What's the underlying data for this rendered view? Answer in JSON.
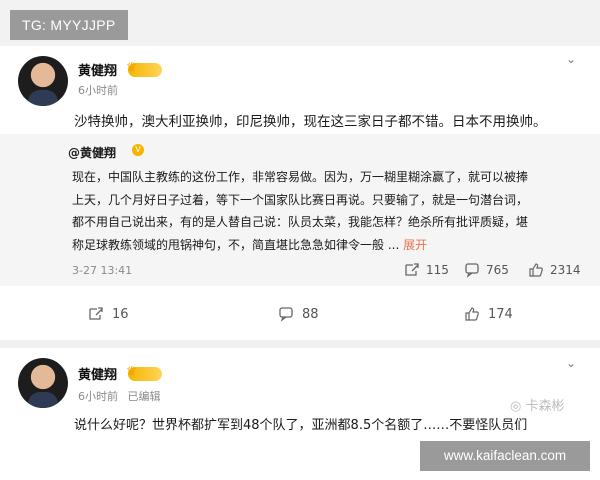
{
  "overlay": {
    "tg_label": "TG: MYYJJPP",
    "site_label": "www.kaifaclean.com"
  },
  "post1": {
    "author": "黄健翔",
    "time": "6小时前",
    "text": "沙特换帅，澳大利亚换帅，印尼换帅，现在这三家日子都不错。日本不用换帅。",
    "repost": {
      "author": "@黄健翔",
      "lines": [
        "现在，中国队主教练的这份工作，非常容易做。因为，万一糊里糊涂赢了，就可以被捧",
        "上天，几个月好日子过着，等下一个国家队比赛日再说。只要输了，就是一句潜台词，",
        "都不用自己说出来，有的是人替自己说：队员太菜，我能怎样？绝杀所有批评质疑，堪",
        "称足球教练领域的甩锅神句，不，简直堪比急急如律令一般 ..."
      ],
      "expand": "展开",
      "date": "3-27 13:41",
      "reposts": "115",
      "comments": "765",
      "likes": "2314"
    },
    "actions": {
      "reposts": "16",
      "comments": "88",
      "likes": "174"
    }
  },
  "post2": {
    "author": "黄健翔",
    "time": "6小时前",
    "edited": "已编辑",
    "text": "说什么好呢？世界杯都扩军到48个队了，亚洲都8.5个名额了……不要怪队员们",
    "watermark": "卡森彬"
  }
}
